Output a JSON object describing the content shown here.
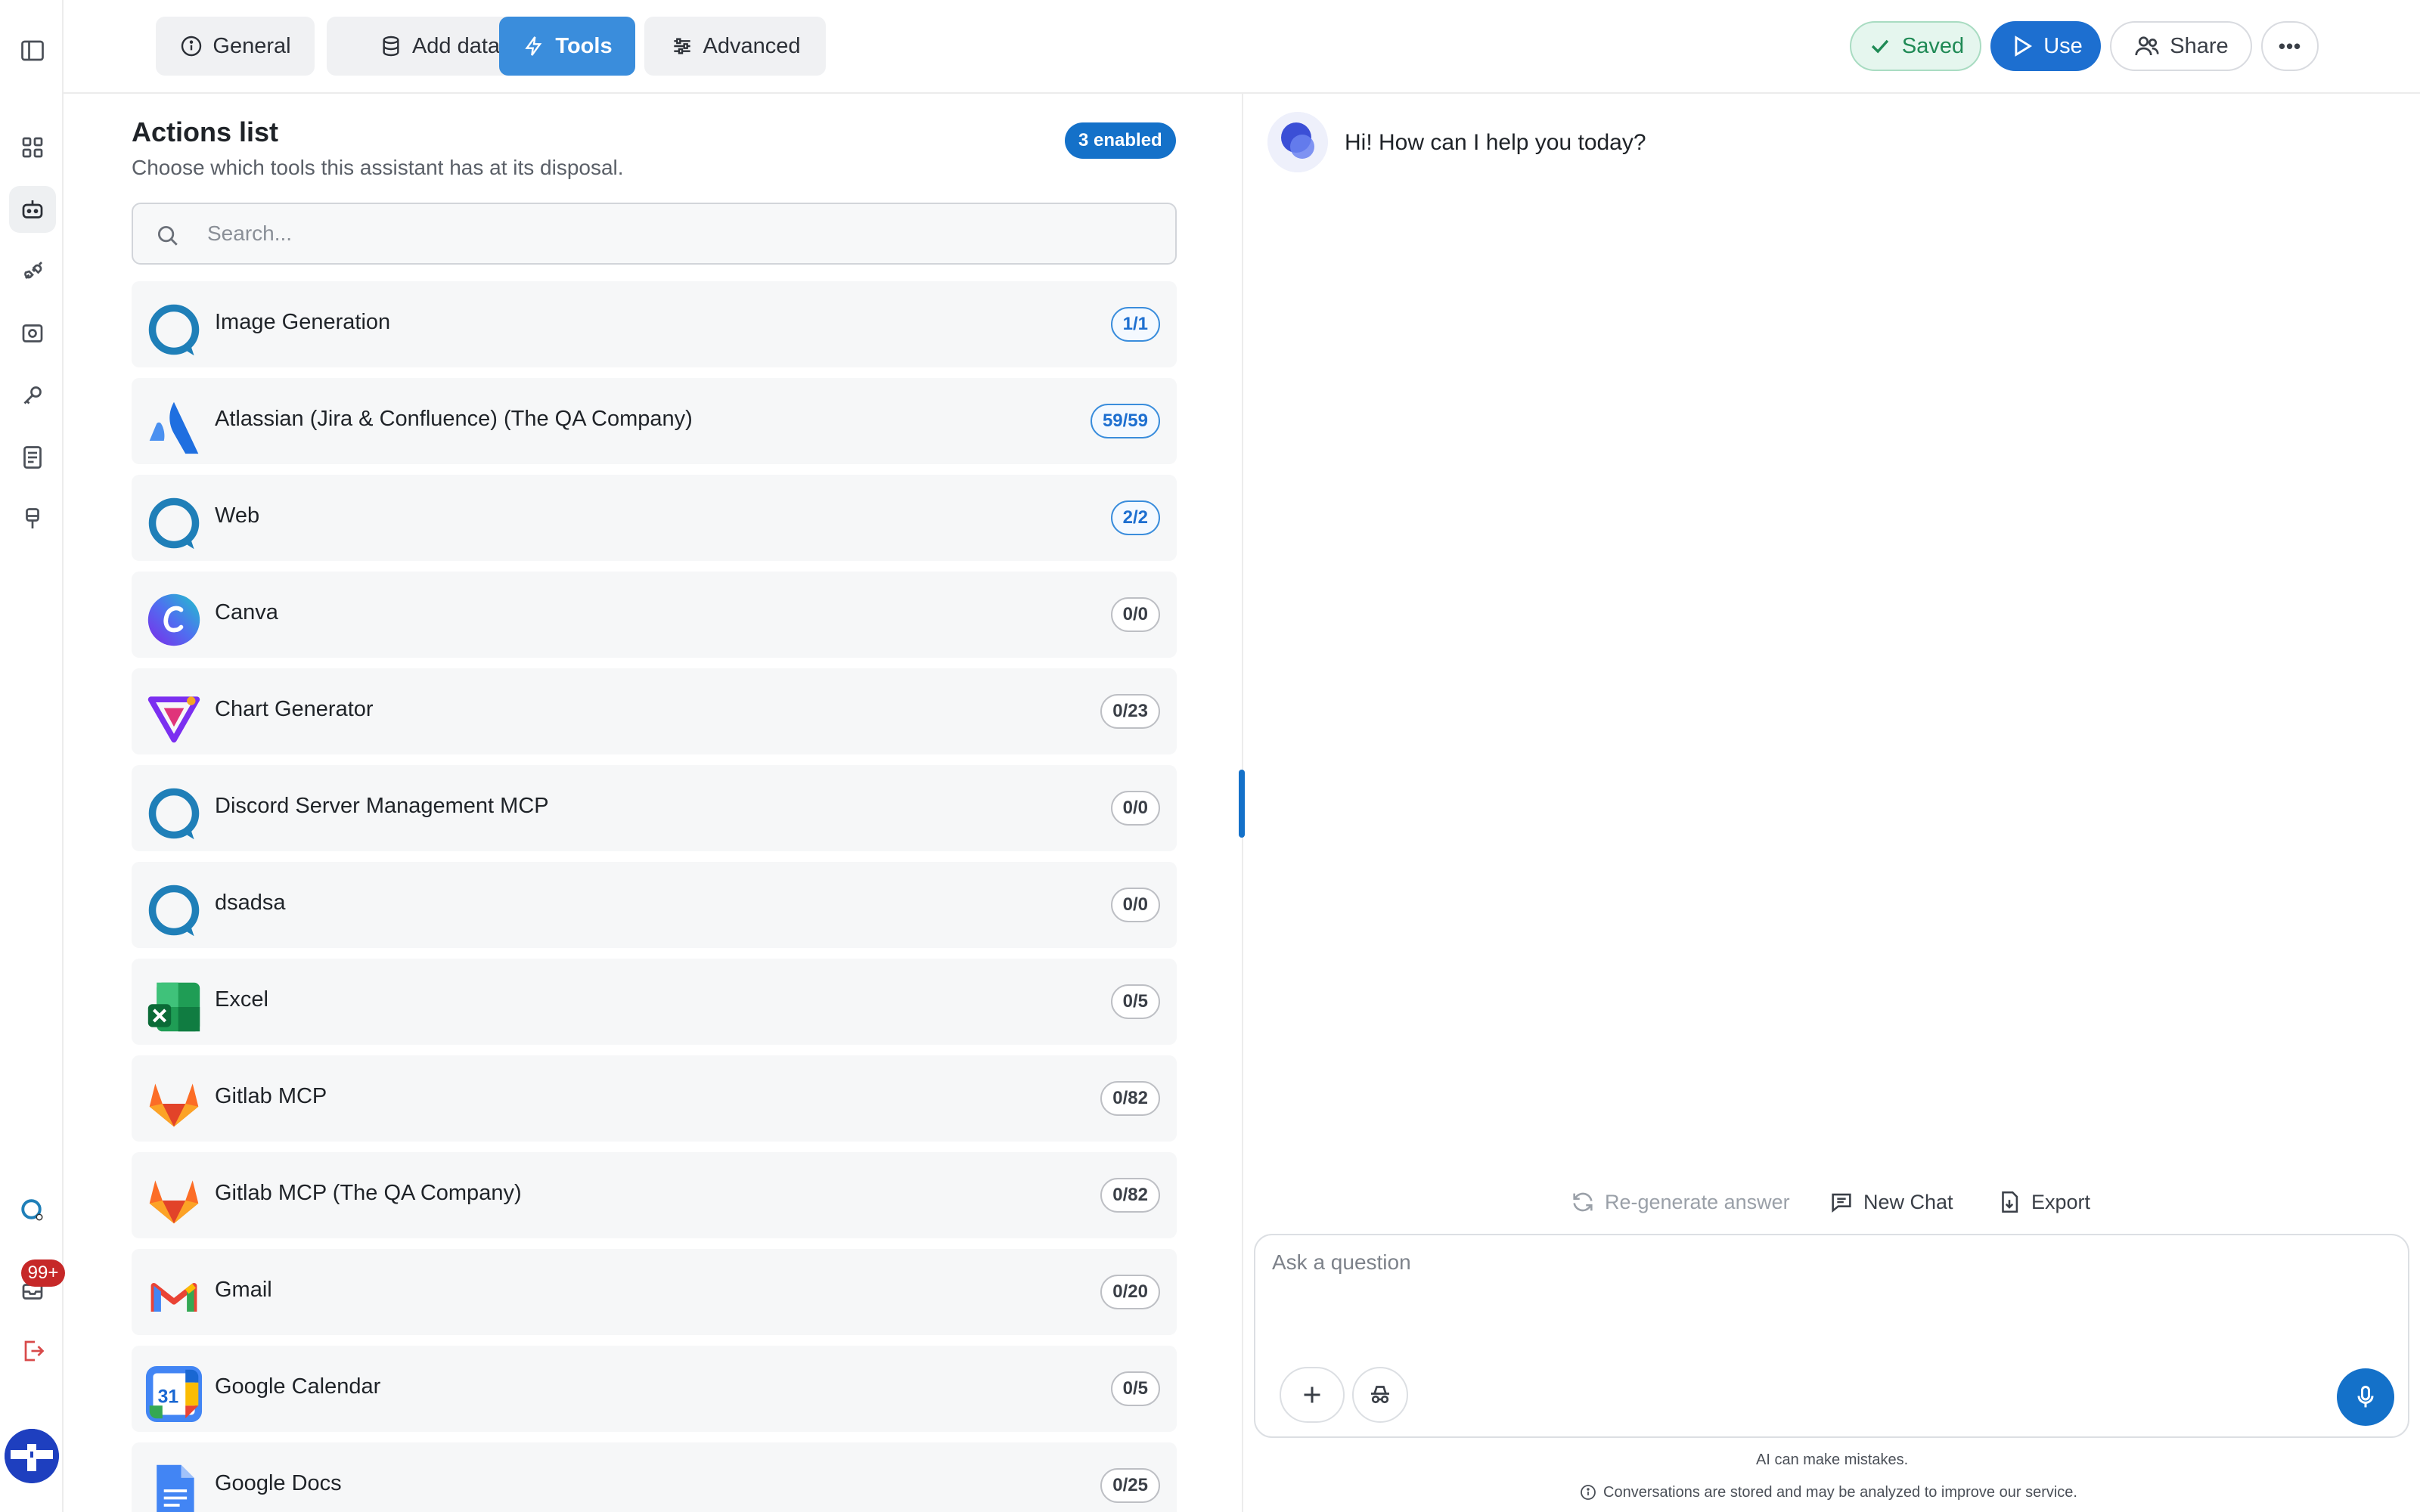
{
  "tabs": [
    {
      "label": "General",
      "icon": "info-icon"
    },
    {
      "label": "Add data",
      "icon": "database-icon"
    },
    {
      "label": "Tools",
      "icon": "lightning-icon"
    },
    {
      "label": "Advanced",
      "icon": "sliders-icon"
    }
  ],
  "header": {
    "saved_label": "Saved",
    "use_label": "Use",
    "share_label": "Share",
    "more_label": "•••"
  },
  "sidebar": {
    "notification_count": "99+"
  },
  "actions": {
    "title": "Actions list",
    "subtitle": "Choose which tools this assistant has at its disposal.",
    "enabled_badge": "3 enabled",
    "search_placeholder": "Search...",
    "tools": [
      {
        "name": "Image Generation",
        "count": "1/1",
        "icon": "platform-logo-icon"
      },
      {
        "name": "Atlassian (Jira & Confluence) (The QA Company)",
        "count": "59/59",
        "icon": "atlassian-logo-icon"
      },
      {
        "name": "Web",
        "count": "2/2",
        "icon": "platform-logo-icon"
      },
      {
        "name": "Canva",
        "count": "0/0",
        "icon": "canva-logo-icon"
      },
      {
        "name": "Chart Generator",
        "count": "0/23",
        "icon": "chart-generator-logo-icon"
      },
      {
        "name": "Discord Server Management MCP",
        "count": "0/0",
        "icon": "platform-logo-icon"
      },
      {
        "name": "dsadsa",
        "count": "0/0",
        "icon": "platform-logo-icon"
      },
      {
        "name": "Excel",
        "count": "0/5",
        "icon": "excel-logo-icon"
      },
      {
        "name": "Gitlab MCP",
        "count": "0/82",
        "icon": "gitlab-logo-icon"
      },
      {
        "name": "Gitlab MCP (The QA Company)",
        "count": "0/82",
        "icon": "gitlab-logo-icon"
      },
      {
        "name": "Gmail",
        "count": "0/20",
        "icon": "gmail-logo-icon"
      },
      {
        "name": "Google Calendar",
        "count": "0/5",
        "icon": "google-calendar-logo-icon"
      },
      {
        "name": "Google Docs",
        "count": "0/25",
        "icon": "google-docs-logo-icon"
      }
    ]
  },
  "calendar_icon_text": "31",
  "chat": {
    "greeting": "Hi! How can I help you today?",
    "regenerate_label": "Re-generate answer",
    "new_chat_label": "New Chat",
    "export_label": "Export",
    "input_placeholder": "Ask a question",
    "disclaimer_1": "AI can make mistakes.",
    "disclaimer_2": "Conversations are stored and may be analyzed to improve our service."
  },
  "colors": {
    "accent": "#1471c9",
    "tab_active": "#3a8ddc",
    "saved_green": "#1f8a55",
    "notification_red": "#c62828"
  }
}
